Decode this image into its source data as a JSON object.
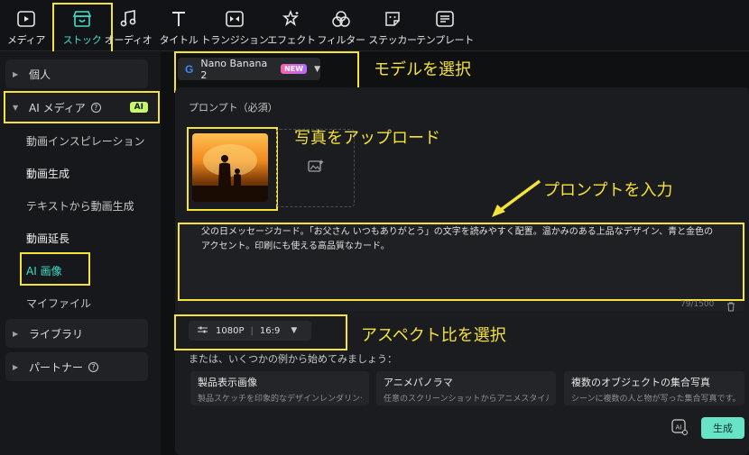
{
  "toolbar": {
    "items": [
      {
        "label": "メディア",
        "icon": "media-icon"
      },
      {
        "label": "ストック",
        "icon": "stock-icon"
      },
      {
        "label": "オーディオ",
        "icon": "music-note-icon"
      },
      {
        "label": "タイトル",
        "icon": "title-t-icon"
      },
      {
        "label": "トランジション",
        "icon": "transition-icon"
      },
      {
        "label": "エフェクト",
        "icon": "effect-star-icon"
      },
      {
        "label": "フィルター",
        "icon": "filter-icon"
      },
      {
        "label": "ステッカー",
        "icon": "sticker-icon"
      },
      {
        "label": "テンプレート",
        "icon": "template-icon"
      }
    ],
    "active_label": "ストック"
  },
  "sidebar": {
    "personal": "個人",
    "ai_media": "AI メディア",
    "ai_badge": "AI",
    "sub_items": [
      "動画インスピレーション",
      "動画生成",
      "テキストから動画生成",
      "動画延長",
      "AI 画像",
      "マイファイル"
    ],
    "active_item": "AI 画像",
    "library": "ライブラリ",
    "partner": "パートナー"
  },
  "main": {
    "model": {
      "name": "Nano Banana 2",
      "badge": "NEW"
    },
    "prompt_label": "プロンプト（必須）",
    "prompt_text": "父の日メッセージカード。「お父さん いつもありがとう」の文字を読みやすく配置。温かみのある上品なデザイン、青と金色のアクセント。印刷にも使える高品質なカード。",
    "counter": "79/1500",
    "resolution": "1080P",
    "aspect": "16:9",
    "examples_label": "または、いくつかの例から始めてみましょう：",
    "examples": [
      {
        "title": "製品表示画像",
        "desc": "製品スケッチを印象的なデザインレンダリング..."
      },
      {
        "title": "アニメパノラマ",
        "desc": "任意のスクリーンショットからアニメスタイルのパ..."
      },
      {
        "title": "複数のオブジェクトの集合写真",
        "desc": "シーンに複数の人と物が写った集合写真です。"
      }
    ],
    "generate": "生成"
  },
  "annotations": {
    "select_model": "モデルを選択",
    "upload_photo": "写真をアップロード",
    "enter_prompt": "プロンプトを入力",
    "select_aspect": "アスペクト比を選択"
  },
  "colors": {
    "accent": "#3fe0c8",
    "highlight": "#f5e23a",
    "generate": "#67e3c6",
    "ai_badge": "#c7f76a"
  }
}
